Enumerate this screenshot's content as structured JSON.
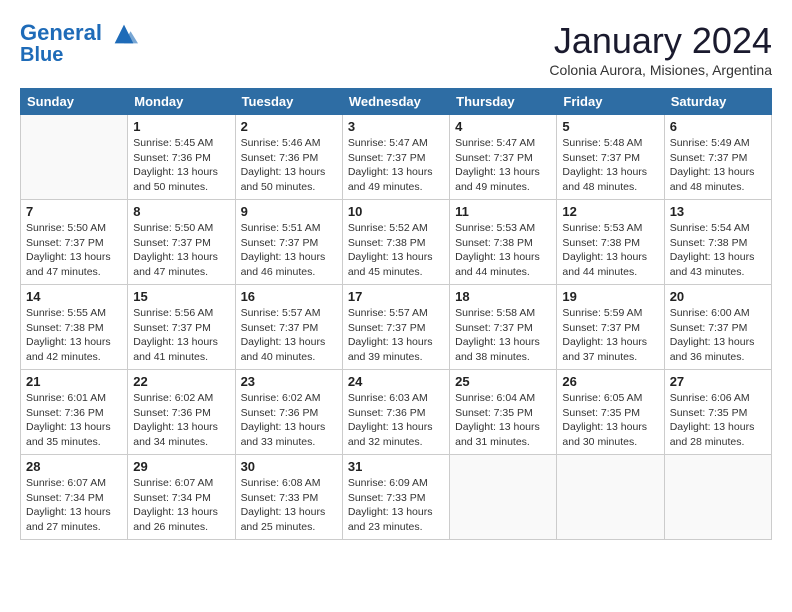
{
  "logo": {
    "line1": "General",
    "line2": "Blue"
  },
  "title": "January 2024",
  "location": "Colonia Aurora, Misiones, Argentina",
  "days_of_week": [
    "Sunday",
    "Monday",
    "Tuesday",
    "Wednesday",
    "Thursday",
    "Friday",
    "Saturday"
  ],
  "weeks": [
    [
      {
        "day": "",
        "info": ""
      },
      {
        "day": "1",
        "info": "Sunrise: 5:45 AM\nSunset: 7:36 PM\nDaylight: 13 hours\nand 50 minutes."
      },
      {
        "day": "2",
        "info": "Sunrise: 5:46 AM\nSunset: 7:36 PM\nDaylight: 13 hours\nand 50 minutes."
      },
      {
        "day": "3",
        "info": "Sunrise: 5:47 AM\nSunset: 7:37 PM\nDaylight: 13 hours\nand 49 minutes."
      },
      {
        "day": "4",
        "info": "Sunrise: 5:47 AM\nSunset: 7:37 PM\nDaylight: 13 hours\nand 49 minutes."
      },
      {
        "day": "5",
        "info": "Sunrise: 5:48 AM\nSunset: 7:37 PM\nDaylight: 13 hours\nand 48 minutes."
      },
      {
        "day": "6",
        "info": "Sunrise: 5:49 AM\nSunset: 7:37 PM\nDaylight: 13 hours\nand 48 minutes."
      }
    ],
    [
      {
        "day": "7",
        "info": "Sunrise: 5:50 AM\nSunset: 7:37 PM\nDaylight: 13 hours\nand 47 minutes."
      },
      {
        "day": "8",
        "info": "Sunrise: 5:50 AM\nSunset: 7:37 PM\nDaylight: 13 hours\nand 47 minutes."
      },
      {
        "day": "9",
        "info": "Sunrise: 5:51 AM\nSunset: 7:37 PM\nDaylight: 13 hours\nand 46 minutes."
      },
      {
        "day": "10",
        "info": "Sunrise: 5:52 AM\nSunset: 7:38 PM\nDaylight: 13 hours\nand 45 minutes."
      },
      {
        "day": "11",
        "info": "Sunrise: 5:53 AM\nSunset: 7:38 PM\nDaylight: 13 hours\nand 44 minutes."
      },
      {
        "day": "12",
        "info": "Sunrise: 5:53 AM\nSunset: 7:38 PM\nDaylight: 13 hours\nand 44 minutes."
      },
      {
        "day": "13",
        "info": "Sunrise: 5:54 AM\nSunset: 7:38 PM\nDaylight: 13 hours\nand 43 minutes."
      }
    ],
    [
      {
        "day": "14",
        "info": "Sunrise: 5:55 AM\nSunset: 7:38 PM\nDaylight: 13 hours\nand 42 minutes."
      },
      {
        "day": "15",
        "info": "Sunrise: 5:56 AM\nSunset: 7:37 PM\nDaylight: 13 hours\nand 41 minutes."
      },
      {
        "day": "16",
        "info": "Sunrise: 5:57 AM\nSunset: 7:37 PM\nDaylight: 13 hours\nand 40 minutes."
      },
      {
        "day": "17",
        "info": "Sunrise: 5:57 AM\nSunset: 7:37 PM\nDaylight: 13 hours\nand 39 minutes."
      },
      {
        "day": "18",
        "info": "Sunrise: 5:58 AM\nSunset: 7:37 PM\nDaylight: 13 hours\nand 38 minutes."
      },
      {
        "day": "19",
        "info": "Sunrise: 5:59 AM\nSunset: 7:37 PM\nDaylight: 13 hours\nand 37 minutes."
      },
      {
        "day": "20",
        "info": "Sunrise: 6:00 AM\nSunset: 7:37 PM\nDaylight: 13 hours\nand 36 minutes."
      }
    ],
    [
      {
        "day": "21",
        "info": "Sunrise: 6:01 AM\nSunset: 7:36 PM\nDaylight: 13 hours\nand 35 minutes."
      },
      {
        "day": "22",
        "info": "Sunrise: 6:02 AM\nSunset: 7:36 PM\nDaylight: 13 hours\nand 34 minutes."
      },
      {
        "day": "23",
        "info": "Sunrise: 6:02 AM\nSunset: 7:36 PM\nDaylight: 13 hours\nand 33 minutes."
      },
      {
        "day": "24",
        "info": "Sunrise: 6:03 AM\nSunset: 7:36 PM\nDaylight: 13 hours\nand 32 minutes."
      },
      {
        "day": "25",
        "info": "Sunrise: 6:04 AM\nSunset: 7:35 PM\nDaylight: 13 hours\nand 31 minutes."
      },
      {
        "day": "26",
        "info": "Sunrise: 6:05 AM\nSunset: 7:35 PM\nDaylight: 13 hours\nand 30 minutes."
      },
      {
        "day": "27",
        "info": "Sunrise: 6:06 AM\nSunset: 7:35 PM\nDaylight: 13 hours\nand 28 minutes."
      }
    ],
    [
      {
        "day": "28",
        "info": "Sunrise: 6:07 AM\nSunset: 7:34 PM\nDaylight: 13 hours\nand 27 minutes."
      },
      {
        "day": "29",
        "info": "Sunrise: 6:07 AM\nSunset: 7:34 PM\nDaylight: 13 hours\nand 26 minutes."
      },
      {
        "day": "30",
        "info": "Sunrise: 6:08 AM\nSunset: 7:33 PM\nDaylight: 13 hours\nand 25 minutes."
      },
      {
        "day": "31",
        "info": "Sunrise: 6:09 AM\nSunset: 7:33 PM\nDaylight: 13 hours\nand 23 minutes."
      },
      {
        "day": "",
        "info": ""
      },
      {
        "day": "",
        "info": ""
      },
      {
        "day": "",
        "info": ""
      }
    ]
  ]
}
